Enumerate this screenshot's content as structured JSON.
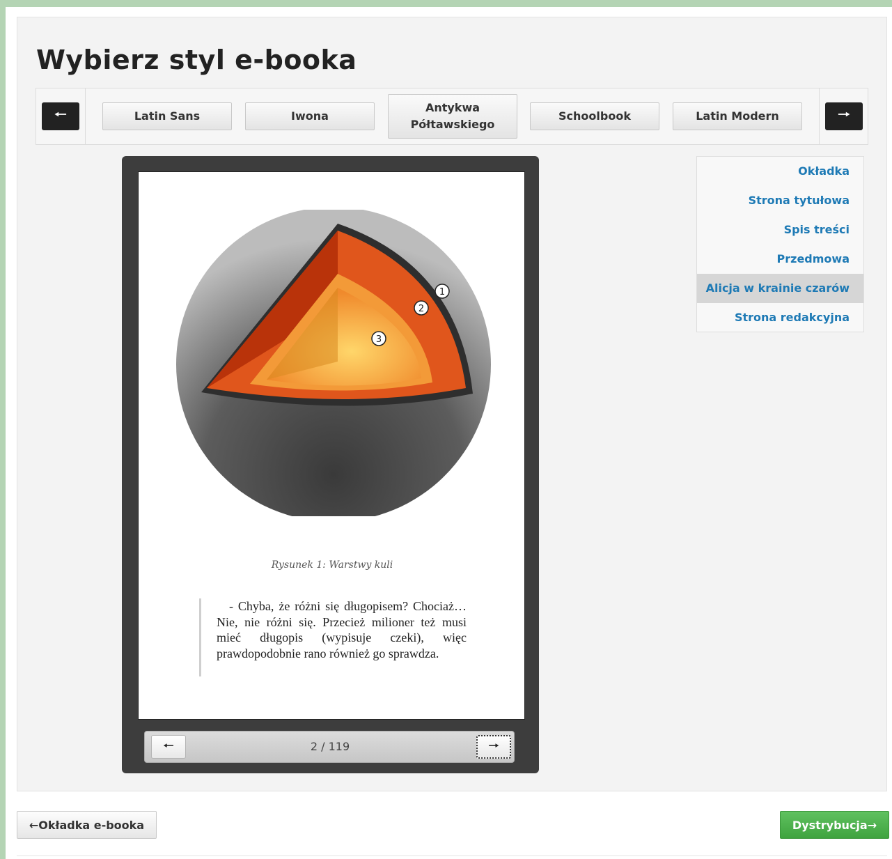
{
  "page": {
    "title": "Wybierz styl e-booka"
  },
  "font_selector": {
    "prev_icon": "arrow-left-icon",
    "next_icon": "arrow-right-icon",
    "options": [
      {
        "label": "Latin Sans",
        "selected": false
      },
      {
        "label": "Iwona",
        "selected": false
      },
      {
        "label": "Antykwa Półtawskiego",
        "selected": true
      },
      {
        "label": "Schoolbook",
        "selected": false
      },
      {
        "label": "Latin Modern",
        "selected": false
      }
    ]
  },
  "preview": {
    "figure_markers": [
      "1",
      "2",
      "3"
    ],
    "caption": "Rysunek 1: Warstwy kuli",
    "quote": "- Chyba, że różni się długopisem? Chociaż… Nie, nie różni się. Przecież milioner też musi mieć długopis (wypisuje czeki), więc prawdopodobnie rano również go sprawdza.",
    "pager": {
      "current_page": 2,
      "total_pages": 119,
      "label": "2 / 119",
      "prev_glyph": "🠐",
      "next_glyph": "🠒"
    }
  },
  "toc": {
    "items": [
      {
        "label": "Okładka",
        "active": false
      },
      {
        "label": "Strona tytułowa",
        "active": false
      },
      {
        "label": "Spis treści",
        "active": false
      },
      {
        "label": "Przedmowa",
        "active": false
      },
      {
        "label": "Alicja w krainie czarów",
        "active": true
      },
      {
        "label": "Strona redakcyjna",
        "active": false
      }
    ]
  },
  "footer": {
    "back_label": "←Okładka e-booka",
    "next_label": "Dystrybucja→"
  },
  "colors": {
    "link": "#1e7ab5",
    "primary_green": "#4cb24c",
    "dark_button": "#222222"
  }
}
